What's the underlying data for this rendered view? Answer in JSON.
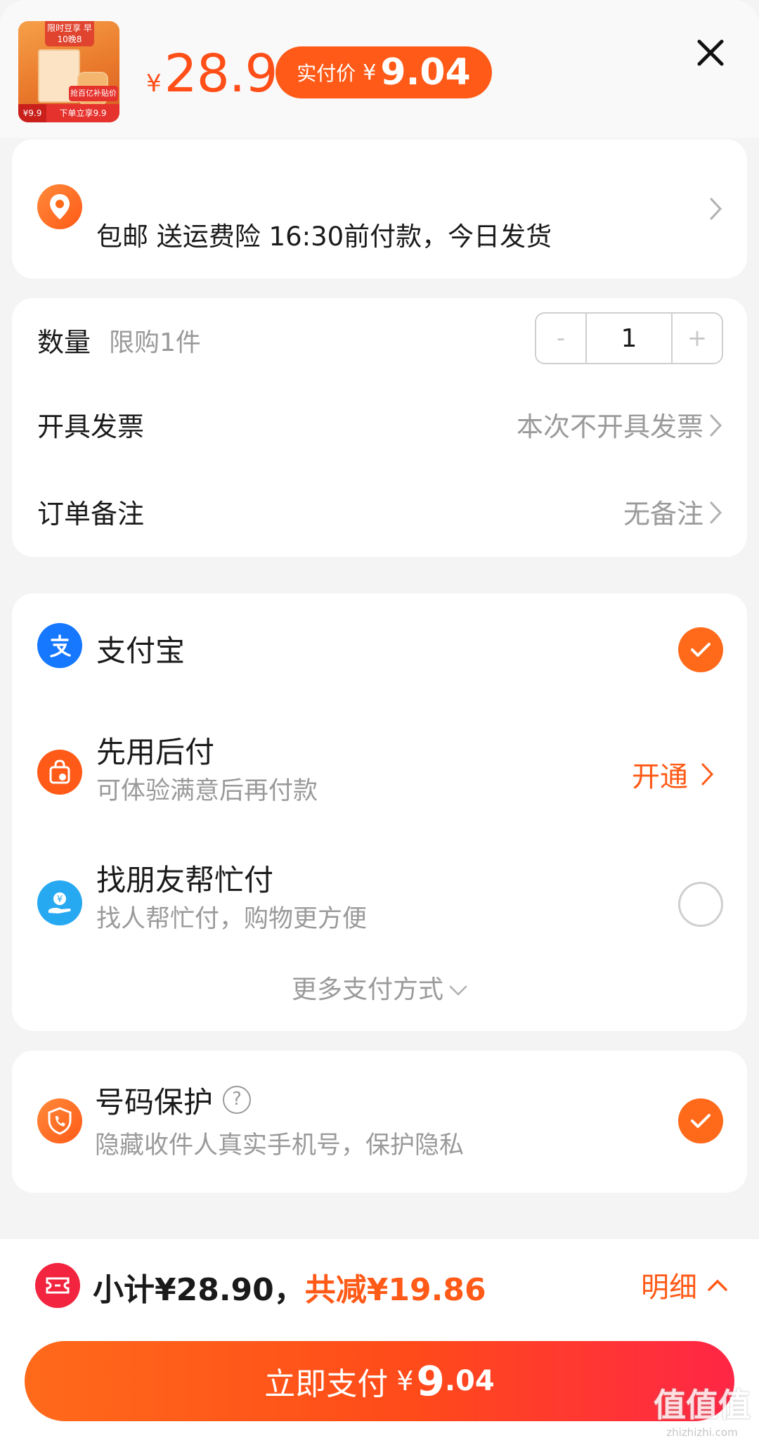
{
  "header": {
    "product_thumb": {
      "top_tag": "限时豆享 早10晚8",
      "mid_label": "抢百亿补贴价",
      "bottom_price": "¥9.9",
      "bottom_text": "下单立享9.9"
    },
    "price_currency": "¥",
    "price": "28.9",
    "real_price_label": "实付价",
    "real_price_currency": "¥",
    "real_price": "9.04",
    "close_icon": "close-icon"
  },
  "address": {
    "icon": "location-pin-icon",
    "shipping_text": "包邮 送运费险 16:30前付款，今日发货"
  },
  "order": {
    "quantity_label": "数量",
    "quantity_limit": "限购1件",
    "quantity_minus": "-",
    "quantity_value": "1",
    "quantity_plus": "+",
    "invoice_label": "开具发票",
    "invoice_value": "本次不开具发票",
    "remark_label": "订单备注",
    "remark_value": "无备注"
  },
  "payment": {
    "methods": [
      {
        "title": "支付宝",
        "sub": "",
        "icon": "alipay-icon",
        "state": "selected"
      },
      {
        "title": "先用后付",
        "sub": "可体验满意后再付款",
        "icon": "shopping-bag-icon",
        "action": "开通"
      },
      {
        "title": "找朋友帮忙付",
        "sub": "找人帮忙付，购物更方便",
        "icon": "hand-money-icon",
        "state": "unselected"
      }
    ],
    "more_label": "更多支付方式"
  },
  "protection": {
    "title": "号码保护",
    "sub": "隐藏收件人真实手机号，保护隐私",
    "icon": "phone-shield-icon",
    "state": "selected"
  },
  "footer": {
    "subtotal_text": "小计¥28.90，",
    "discount_text": "共减¥19.86",
    "detail_label": "明细",
    "pay_label": "立即支付",
    "pay_currency": "¥",
    "pay_int": "9",
    "pay_dec": ".04"
  },
  "watermark": {
    "text": "值值值",
    "sub": "zhizhizhi.com"
  },
  "colors": {
    "accent": "#ff5a17",
    "pay_gradient_end": "#ff2646",
    "alipay_blue": "#1677ff"
  }
}
